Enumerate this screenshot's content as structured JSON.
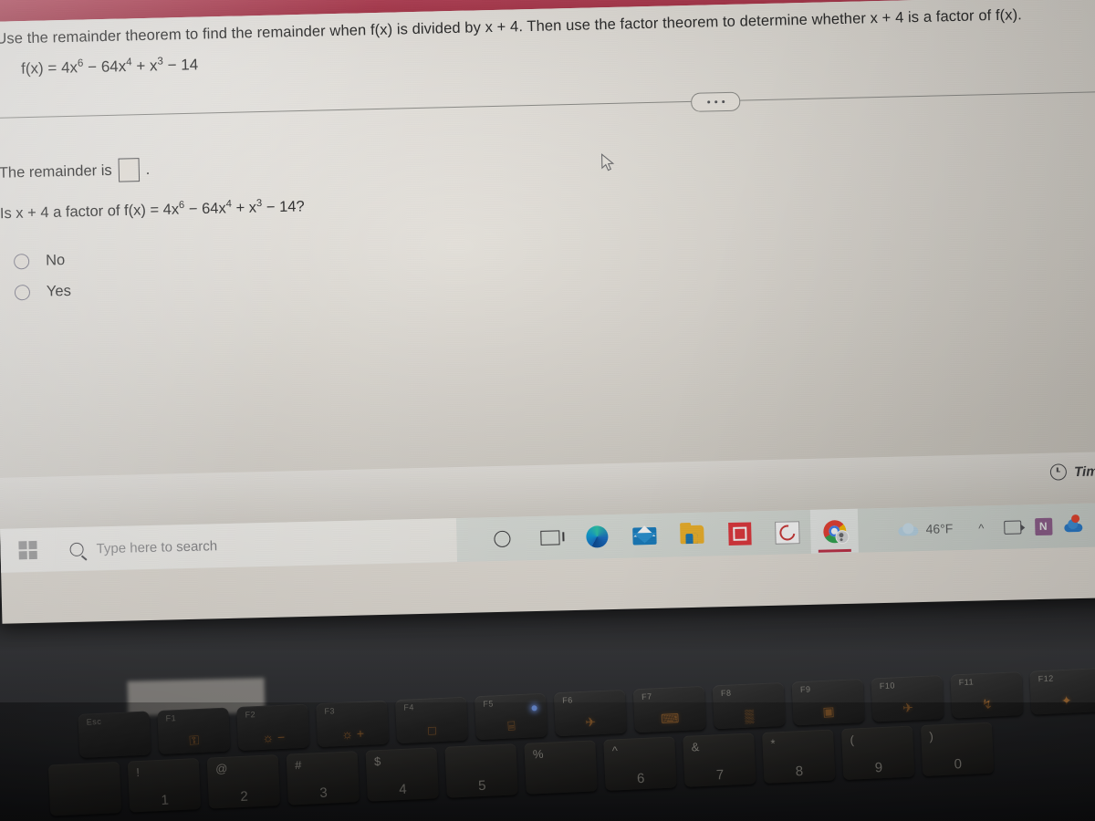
{
  "question": {
    "prompt": "Use the remainder theorem to find the remainder when f(x) is divided by x + 4. Then use the factor theorem to determine whether x + 4 is a factor of f(x).",
    "function_line": "f(x) = 4x6 − 64x4 + x3 − 14",
    "function_parts": {
      "lead": "f(x) = 4x",
      "exp1": "6",
      "mid1": " − 64x",
      "exp2": "4",
      "mid2": " + x",
      "exp3": "3",
      "tail": " − 14"
    }
  },
  "answer_area": {
    "remainder_label": "The remainder is",
    "remainder_value": "",
    "remainder_period": ".",
    "factor_question_parts": {
      "lead": "Is x + 4 a factor of f(x) = 4x",
      "exp1": "6",
      "mid1": " − 64x",
      "exp2": "4",
      "mid2": " + x",
      "exp3": "3",
      "tail": " − 14?"
    },
    "choices": [
      {
        "label": "No",
        "selected": false
      },
      {
        "label": "Yes",
        "selected": false
      }
    ],
    "more_options_label": "…"
  },
  "timer": {
    "label": "Time R",
    "icon": "clock-icon"
  },
  "taskbar": {
    "start_icon": "windows-logo-icon",
    "search": {
      "placeholder": "Type here to search",
      "value": "",
      "icon": "search-icon"
    },
    "buttons": [
      {
        "name": "cortana-button",
        "icon": "circle-icon"
      },
      {
        "name": "task-view-button",
        "icon": "task-view-icon"
      },
      {
        "name": "edge-button",
        "icon": "edge-icon"
      },
      {
        "name": "mail-button",
        "icon": "mail-icon"
      },
      {
        "name": "file-explorer-button",
        "icon": "folder-icon"
      },
      {
        "name": "screen-recorder-button",
        "icon": "record-stop-icon"
      },
      {
        "name": "sync-app-button",
        "icon": "sync-icon"
      },
      {
        "name": "chrome-button",
        "icon": "chrome-icon",
        "active": true
      }
    ],
    "tray": {
      "weather": {
        "temperature": "46°F",
        "icon": "cloud-icon"
      },
      "show_hidden_icons": "^",
      "icons": [
        {
          "name": "webcam-tray-icon",
          "icon": "camera-icon"
        },
        {
          "name": "onenote-tray-icon",
          "icon": "onenote-icon",
          "glyph": "N"
        },
        {
          "name": "onedrive-tray-icon",
          "icon": "onedrive-icon"
        },
        {
          "name": "sync-status-tray-icon",
          "icon": "sync-box-icon"
        }
      ]
    }
  },
  "keyboard": {
    "function_row": [
      {
        "label": "Esc",
        "glyph": ""
      },
      {
        "label": "F1",
        "glyph": "⚿"
      },
      {
        "label": "F2",
        "glyph": "☼ −"
      },
      {
        "label": "F3",
        "glyph": "☼ +"
      },
      {
        "label": "F4",
        "glyph": "□"
      },
      {
        "label": "F5",
        "glyph": "⌸",
        "led": true
      },
      {
        "label": "F6",
        "glyph": "✈"
      },
      {
        "label": "F7",
        "glyph": "⌨"
      },
      {
        "label": "F8",
        "glyph": "▒"
      },
      {
        "label": "F9",
        "glyph": "▣"
      },
      {
        "label": "F10",
        "glyph": "✈"
      },
      {
        "label": "F11",
        "glyph": "↯"
      },
      {
        "label": "F12",
        "glyph": "✦"
      }
    ],
    "number_row": [
      {
        "label": "",
        "glyph": ""
      },
      {
        "label": "!",
        "glyph": "1"
      },
      {
        "label": "@",
        "glyph": "2"
      },
      {
        "label": "#",
        "glyph": "3"
      },
      {
        "label": "$",
        "glyph": "4"
      },
      {
        "label": "",
        "glyph": "5"
      },
      {
        "label": "%",
        "glyph": ""
      },
      {
        "label": "^",
        "glyph": "6"
      },
      {
        "label": "&",
        "glyph": "7"
      },
      {
        "label": "*",
        "glyph": "8"
      },
      {
        "label": "(",
        "glyph": "9"
      },
      {
        "label": ")",
        "glyph": "0"
      }
    ]
  },
  "colors": {
    "top_bar": "#bf3e55",
    "page_background": "#e4dfd6",
    "taskbar": "#d7dcd6",
    "bezel": "#36373a",
    "text": "#2b2b2b",
    "active_indicator": "#c2334a"
  }
}
